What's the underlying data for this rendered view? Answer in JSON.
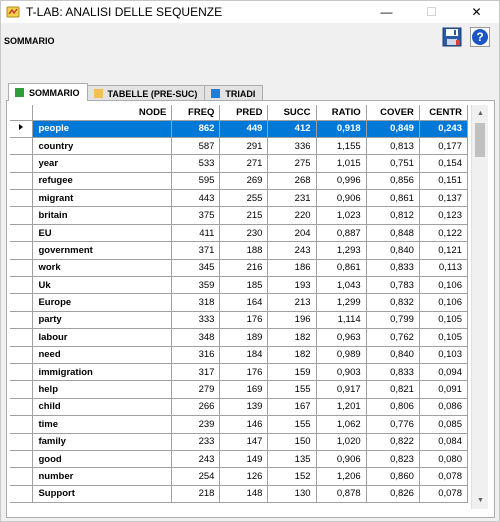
{
  "window": {
    "title": "T-LAB: ANALISI DELLE SEQUENZE",
    "minimize": "—",
    "maximize": "☐",
    "close": "✕"
  },
  "heading": "SOMMARIO",
  "toolbar": {
    "save_icon": "floppy-disk-icon",
    "help_icon": "help-icon"
  },
  "tabs": [
    {
      "label": "SOMMARIO",
      "color": "#2e9e3a",
      "active": true
    },
    {
      "label": "TABELLE (PRE-SUC)",
      "color": "#f2c14e",
      "active": false
    },
    {
      "label": "TRIADI",
      "color": "#1f7fd6",
      "active": false
    }
  ],
  "table": {
    "columns": [
      "NODE",
      "FREQ",
      "PRED",
      "SUCC",
      "RATIO",
      "COVER",
      "CENTR"
    ],
    "rows": [
      [
        "people",
        "862",
        "449",
        "412",
        "0,918",
        "0,849",
        "0,243"
      ],
      [
        "country",
        "587",
        "291",
        "336",
        "1,155",
        "0,813",
        "0,177"
      ],
      [
        "year",
        "533",
        "271",
        "275",
        "1,015",
        "0,751",
        "0,154"
      ],
      [
        "refugee",
        "595",
        "269",
        "268",
        "0,996",
        "0,856",
        "0,151"
      ],
      [
        "migrant",
        "443",
        "255",
        "231",
        "0,906",
        "0,861",
        "0,137"
      ],
      [
        "britain",
        "375",
        "215",
        "220",
        "1,023",
        "0,812",
        "0,123"
      ],
      [
        "EU",
        "411",
        "230",
        "204",
        "0,887",
        "0,848",
        "0,122"
      ],
      [
        "government",
        "371",
        "188",
        "243",
        "1,293",
        "0,840",
        "0,121"
      ],
      [
        "work",
        "345",
        "216",
        "186",
        "0,861",
        "0,833",
        "0,113"
      ],
      [
        "Uk",
        "359",
        "185",
        "193",
        "1,043",
        "0,783",
        "0,106"
      ],
      [
        "Europe",
        "318",
        "164",
        "213",
        "1,299",
        "0,832",
        "0,106"
      ],
      [
        "party",
        "333",
        "176",
        "196",
        "1,114",
        "0,799",
        "0,105"
      ],
      [
        "labour",
        "348",
        "189",
        "182",
        "0,963",
        "0,762",
        "0,105"
      ],
      [
        "need",
        "316",
        "184",
        "182",
        "0,989",
        "0,840",
        "0,103"
      ],
      [
        "immigration",
        "317",
        "176",
        "159",
        "0,903",
        "0,833",
        "0,094"
      ],
      [
        "help",
        "279",
        "169",
        "155",
        "0,917",
        "0,821",
        "0,091"
      ],
      [
        "child",
        "266",
        "139",
        "167",
        "1,201",
        "0,806",
        "0,086"
      ],
      [
        "time",
        "239",
        "146",
        "155",
        "1,062",
        "0,776",
        "0,085"
      ],
      [
        "family",
        "233",
        "147",
        "150",
        "1,020",
        "0,822",
        "0,084"
      ],
      [
        "good",
        "243",
        "149",
        "135",
        "0,906",
        "0,823",
        "0,080"
      ],
      [
        "number",
        "254",
        "126",
        "152",
        "1,206",
        "0,860",
        "0,078"
      ],
      [
        "Support",
        "218",
        "148",
        "130",
        "0,878",
        "0,826",
        "0,078"
      ]
    ],
    "selected_row": 0
  }
}
